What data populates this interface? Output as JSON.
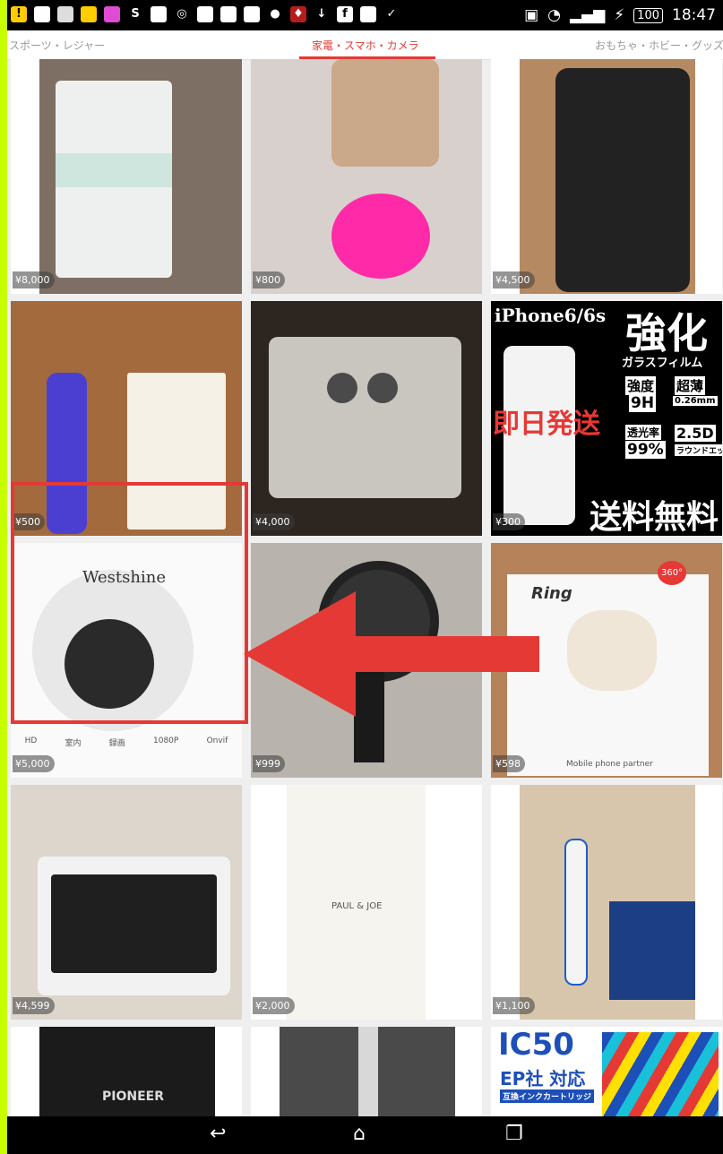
{
  "status_bar": {
    "time": "18:47",
    "battery": "100",
    "icons": [
      "warning-icon",
      "app-icon",
      "sms-icon",
      "app-icon",
      "app-icon",
      "s-icon",
      "app-icon",
      "globe-icon",
      "app-icon",
      "app-icon",
      "image-icon",
      "soccer-icon",
      "shield-icon",
      "download-icon",
      "facebook-icon",
      "calendar-icon",
      "check-icon"
    ]
  },
  "tabs": [
    {
      "label": "スポーツ・レジャー",
      "active": false
    },
    {
      "label": "家電・スマホ・カメラ",
      "active": true
    },
    {
      "label": "おもちゃ・ホビー・グッズ",
      "active": false
    }
  ],
  "products": [
    {
      "price": "¥8,000",
      "kind": "washing-machine"
    },
    {
      "price": "¥800",
      "kind": "mirror-phone-case"
    },
    {
      "price": "¥4,500",
      "kind": "black-phone-case"
    },
    {
      "price": "¥500",
      "kind": "selfie-tripod"
    },
    {
      "price": "¥4,000",
      "kind": "antenna-booster"
    },
    {
      "price": "¥300",
      "kind": "glass-film",
      "ad_text": {
        "line1": "iPhone6/6s",
        "big": "強化",
        "sub": "ガラスフィルム",
        "hard1": "強度",
        "hard2": "9H",
        "thin1": "超薄",
        "thin2": "0.26mm",
        "trans1": "透光率",
        "trans2": "99%",
        "edge1": "2.5D",
        "edge2": "ラウンドエッジ",
        "promo": "即日発送",
        "free": "送料無料"
      }
    },
    {
      "price": "¥5,000",
      "kind": "security-camera",
      "brand": "Westshine",
      "features": [
        "HD",
        "室内",
        "録画",
        "1080P",
        "Onvif"
      ]
    },
    {
      "price": "¥999",
      "kind": "handheld-fan"
    },
    {
      "price": "¥598",
      "kind": "phone-ring",
      "brand": "Ring",
      "tag": "360°",
      "caption": "Mobile phone partner"
    },
    {
      "price": "¥4,599",
      "kind": "pen-tablet"
    },
    {
      "price": "¥2,000",
      "kind": "notebook-case",
      "brand": "PAUL & JOE"
    },
    {
      "price": "¥1,100",
      "kind": "toothbrush"
    },
    {
      "price": "",
      "kind": "pioneer",
      "brand": "PIONEER"
    },
    {
      "price": "",
      "kind": "bottle"
    },
    {
      "price": "",
      "kind": "ink-cartridges",
      "model": "IC50",
      "maker": "EP社 対応",
      "sub": "互換インクカートリッジ"
    }
  ],
  "colors": {
    "accent": "#e53935",
    "page_bg": "#c8ff00"
  }
}
